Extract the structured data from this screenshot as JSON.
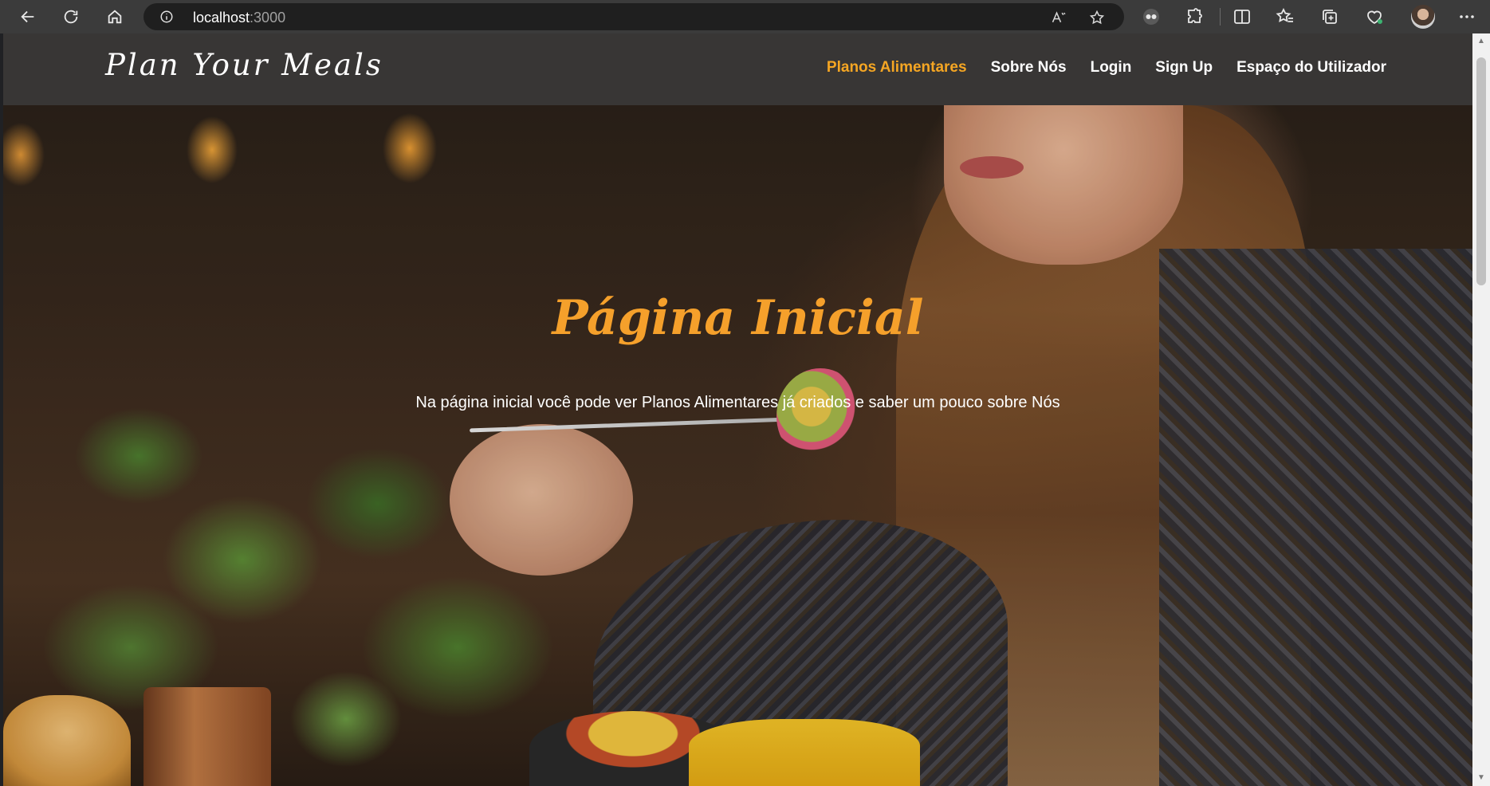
{
  "browser": {
    "url_host": "localhost",
    "url_port": ":3000"
  },
  "site": {
    "brand": "Plan Your Meals",
    "nav": [
      {
        "label": "Planos Alimentares",
        "active": true
      },
      {
        "label": "Sobre Nós",
        "active": false
      },
      {
        "label": "Login",
        "active": false
      },
      {
        "label": "Sign Up",
        "active": false
      },
      {
        "label": "Espaço do Utilizador",
        "active": false
      }
    ]
  },
  "hero": {
    "title": "Página Inicial",
    "subtitle": "Na página inicial você pode ver Planos Alimentares já criados e saber um pouco sobre Nós"
  },
  "colors": {
    "accent": "#f5a623",
    "navbar_bg": "#383635"
  }
}
